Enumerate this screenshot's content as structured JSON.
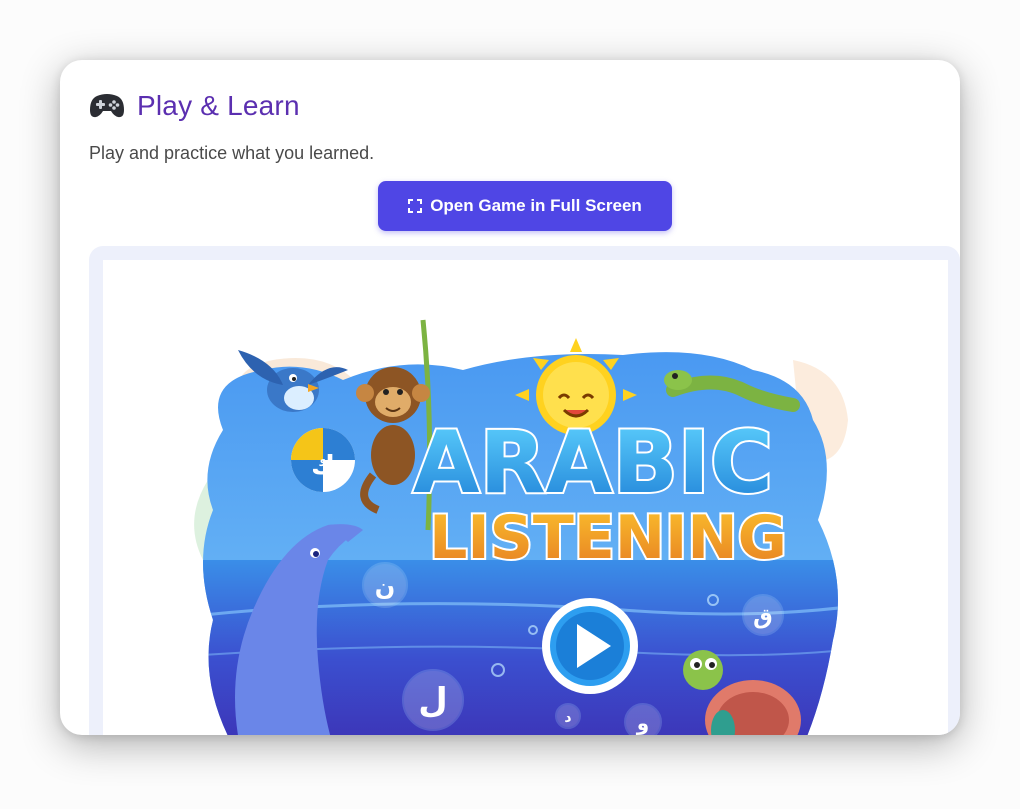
{
  "header": {
    "icon": "gamepad-icon",
    "title": "Play & Learn"
  },
  "subtitle": "Play and practice what you learned.",
  "fullscreen_button": {
    "icon": "expand-icon",
    "label": "Open Game in Full Screen",
    "color": "#4f46e5"
  },
  "game": {
    "title_line1": "ARABIC",
    "title_line2": "LISTENING",
    "ball_letter": "ك",
    "bubble_letters": [
      "ن",
      "ق",
      "ل",
      "د",
      "و"
    ],
    "play_icon": "play-icon"
  },
  "colors": {
    "title": "#5b2fb0",
    "frame_bg": "#edf0fb"
  }
}
